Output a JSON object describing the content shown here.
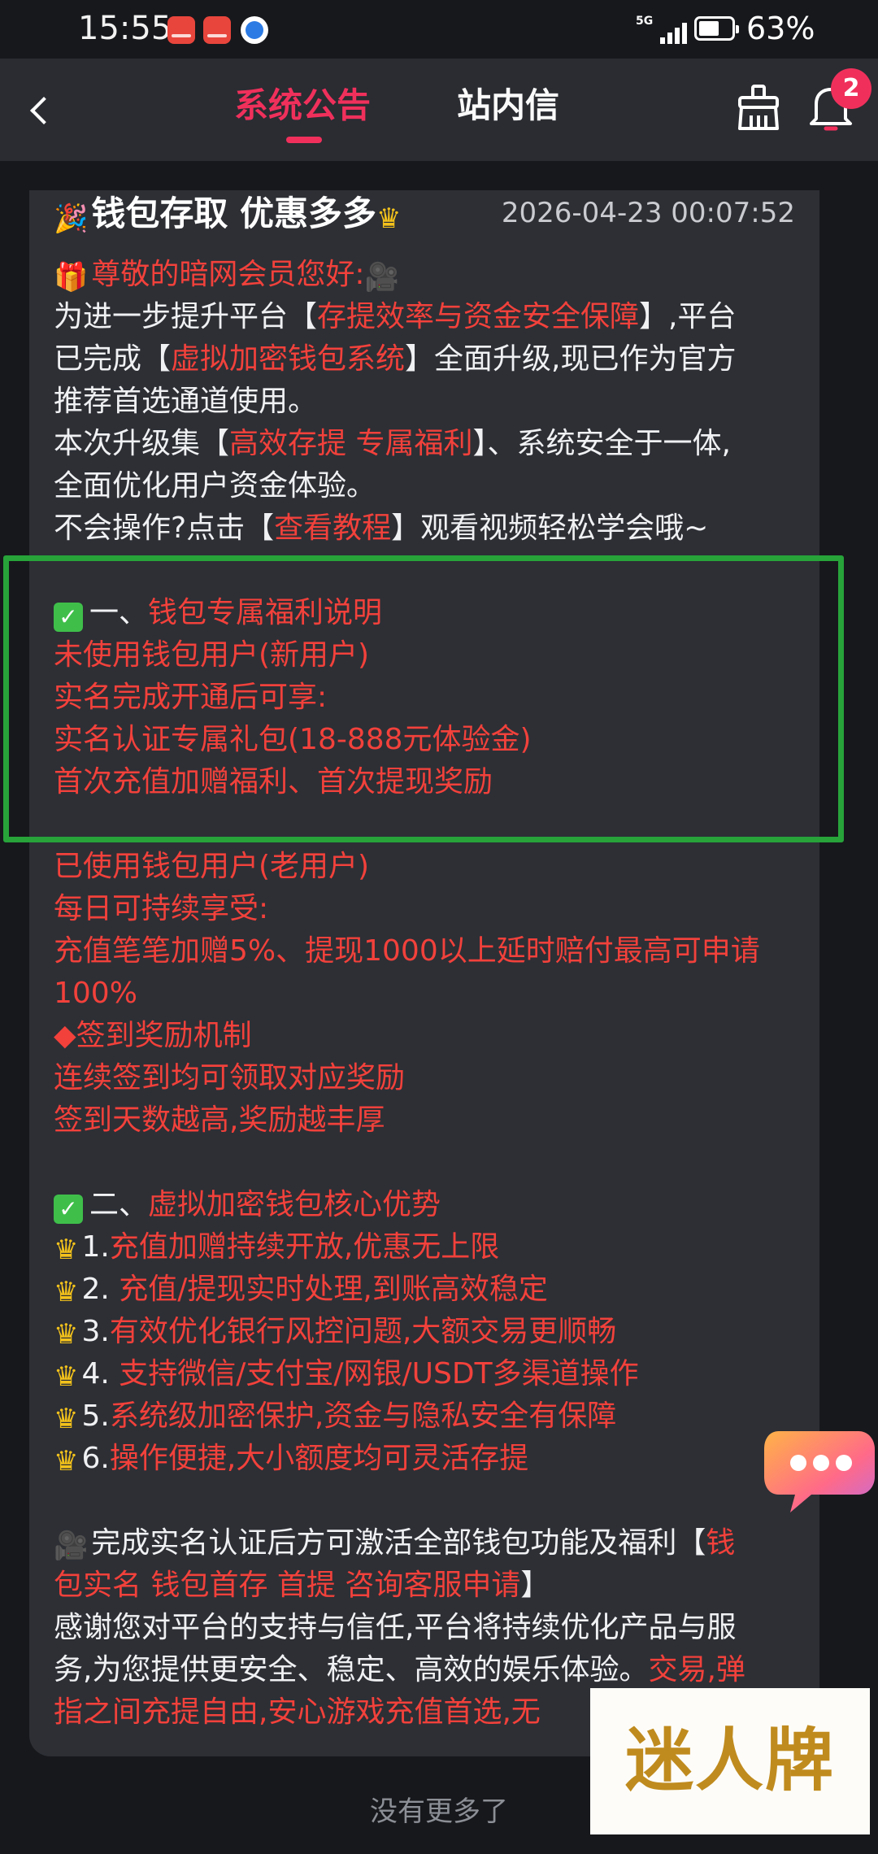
{
  "status_bar": {
    "time": "15:55",
    "network": "5G",
    "battery_percent": "63%",
    "battery_level": 0.63
  },
  "header": {
    "back_icon": "chevron-left-icon",
    "tabs": [
      {
        "label": "系统公告",
        "active": true
      },
      {
        "label": "站内信",
        "active": false
      }
    ],
    "clean_icon": "broom-icon",
    "bell_icon": "bell-icon",
    "notification_count": "2"
  },
  "notice": {
    "title": "钱包存取 优惠多多",
    "date": "2026-04-23 00:07:52",
    "lines": [
      {
        "segments": [
          {
            "c": "r",
            "t": "尊敬的暗网会员您好:"
          }
        ]
      },
      {
        "segments": [
          {
            "c": "w",
            "t": "为进一步提升平台【"
          },
          {
            "c": "r",
            "t": "存提效率与资金安全保障"
          },
          {
            "c": "w",
            "t": "】,平台"
          }
        ]
      },
      {
        "segments": [
          {
            "c": "w",
            "t": "已完成【"
          },
          {
            "c": "r",
            "t": "虚拟加密钱包系统"
          },
          {
            "c": "w",
            "t": "】全面升级,现已作为官方"
          }
        ]
      },
      {
        "segments": [
          {
            "c": "w",
            "t": "推荐首选通道使用。"
          }
        ]
      },
      {
        "segments": [
          {
            "c": "w",
            "t": "本次升级集【"
          },
          {
            "c": "r",
            "t": "高效存提 专属福利"
          },
          {
            "c": "w",
            "t": "】、系统安全于一体,"
          }
        ]
      },
      {
        "segments": [
          {
            "c": "w",
            "t": "全面优化用户资金体验。"
          }
        ]
      },
      {
        "segments": [
          {
            "c": "w",
            "t": "不会操作?点击【"
          },
          {
            "c": "r",
            "t": "查看教程"
          },
          {
            "c": "w",
            "t": "】观看视频轻松学会哦~"
          }
        ]
      },
      {
        "segments": []
      },
      {
        "segments": [
          {
            "c": "w",
            "t": "一、"
          },
          {
            "c": "r",
            "t": "钱包专属福利说明"
          }
        ]
      },
      {
        "segments": [
          {
            "c": "r",
            "t": "未使用钱包用户(新用户)"
          }
        ]
      },
      {
        "segments": [
          {
            "c": "r",
            "t": "实名完成开通后可享:"
          }
        ]
      },
      {
        "segments": [
          {
            "c": "r",
            "t": "实名认证专属礼包(18-888元体验金)"
          }
        ]
      },
      {
        "segments": [
          {
            "c": "r",
            "t": "首次充值加赠福利、首次提现奖励"
          }
        ]
      },
      {
        "segments": []
      },
      {
        "segments": [
          {
            "c": "r",
            "t": "已使用钱包用户(老用户)"
          }
        ]
      },
      {
        "segments": [
          {
            "c": "r",
            "t": "每日可持续享受:"
          }
        ]
      },
      {
        "segments": [
          {
            "c": "r",
            "t": "充值笔笔加赠5%、提现1000以上延时赔付最高可申请"
          }
        ]
      },
      {
        "segments": [
          {
            "c": "r",
            "t": "100%"
          }
        ]
      },
      {
        "segments": [
          {
            "c": "r",
            "t": "◆签到奖励机制"
          }
        ]
      },
      {
        "segments": [
          {
            "c": "r",
            "t": "连续签到均可领取对应奖励"
          }
        ]
      },
      {
        "segments": [
          {
            "c": "r",
            "t": "签到天数越高,奖励越丰厚"
          }
        ]
      },
      {
        "segments": []
      },
      {
        "segments": [
          {
            "c": "w",
            "t": "二、"
          },
          {
            "c": "r",
            "t": "虚拟加密钱包核心优势"
          }
        ]
      },
      {
        "segments": [
          {
            "c": "w",
            "t": "1."
          },
          {
            "c": "r",
            "t": "充值加赠持续开放,优惠无上限"
          }
        ]
      },
      {
        "segments": [
          {
            "c": "w",
            "t": "2."
          },
          {
            "c": "r",
            "t": " 充值/提现实时处理,到账高效稳定"
          }
        ]
      },
      {
        "segments": [
          {
            "c": "w",
            "t": "3."
          },
          {
            "c": "r",
            "t": "有效优化银行风控问题,大额交易更顺畅"
          }
        ]
      },
      {
        "segments": [
          {
            "c": "w",
            "t": "4."
          },
          {
            "c": "r",
            "t": " 支持微信/支付宝/网银/USDT多渠道操作"
          }
        ]
      },
      {
        "segments": [
          {
            "c": "w",
            "t": "5."
          },
          {
            "c": "r",
            "t": "系统级加密保护,资金与隐私安全有保障"
          }
        ]
      },
      {
        "segments": [
          {
            "c": "w",
            "t": "6."
          },
          {
            "c": "r",
            "t": "操作便捷,大小额度均可灵活存提"
          }
        ]
      },
      {
        "segments": []
      },
      {
        "segments": [
          {
            "c": "w",
            "t": "完成实名认证后方可激活全部钱包功能及福利【"
          },
          {
            "c": "r",
            "t": "钱"
          }
        ]
      },
      {
        "segments": [
          {
            "c": "r",
            "t": "包实名 钱包首存 首提 咨询客服申请"
          },
          {
            "c": "w",
            "t": "】"
          }
        ]
      },
      {
        "segments": [
          {
            "c": "w",
            "t": "感谢您对平台的支持与信任,平台将持续优化产品与服"
          }
        ]
      },
      {
        "segments": [
          {
            "c": "w",
            "t": "务,为您提供更安全、稳定、高效的娱乐体验。"
          },
          {
            "c": "r",
            "t": "交易,弹"
          }
        ]
      },
      {
        "segments": [
          {
            "c": "r",
            "t": "指之间充提自由,安心游戏充值首选,无"
          }
        ]
      }
    ]
  },
  "icons": {
    "title_prefix": "party-popper-icon",
    "title_suffix": "crown-icon",
    "greeting_prefix": "gift-icon",
    "greeting_suffix": "film-camera-icon",
    "section_check": "check-mark-icon",
    "list_bullet": "crown-icon",
    "final_prefix": "film-camera-icon"
  },
  "floating_chat_icon": "chat-bubble-icon",
  "watermark": {
    "text": "迷人牌"
  },
  "footer": {
    "text": "没有更多了"
  },
  "colors": {
    "accent": "#f0305b",
    "notice_red": "#f2413b",
    "highlight": "#27a33a",
    "card_bg": "#2d2f35",
    "bg": "#17181c"
  }
}
